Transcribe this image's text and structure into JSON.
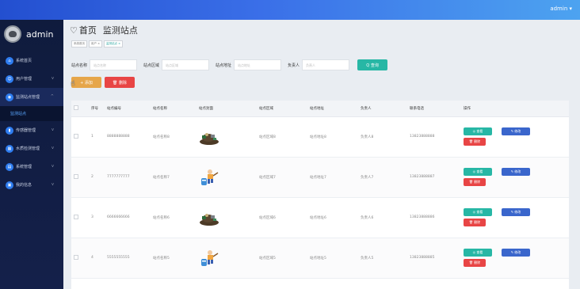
{
  "topbar": {
    "user": "admin ▾"
  },
  "sidebar": {
    "brand": "admin",
    "items": [
      {
        "label": "系统首页",
        "icon": "home-icon",
        "color": "#2f7df0",
        "arrow": ""
      },
      {
        "label": "用户管理",
        "icon": "user-icon",
        "color": "#2f7df0",
        "arrow": "v"
      },
      {
        "label": "监测站点管理",
        "icon": "location-icon",
        "color": "#2f7df0",
        "arrow": "^"
      },
      {
        "label": "传感器管理",
        "icon": "chart-icon",
        "color": "#2f7df0",
        "arrow": "v"
      },
      {
        "label": "水质检测管理",
        "icon": "grid-icon",
        "color": "#2f7df0",
        "arrow": "v"
      },
      {
        "label": "系统管理",
        "icon": "settings-icon",
        "color": "#2f7df0",
        "arrow": "v"
      },
      {
        "label": "我的信息",
        "icon": "info-icon",
        "color": "#2f7df0",
        "arrow": "v"
      }
    ],
    "subitem": "监测站点"
  },
  "page": {
    "home": "首页",
    "title": "监测站点",
    "crumbs": [
      "系统首页",
      "用户 ×",
      "监测站点 ×"
    ]
  },
  "search": {
    "fields": [
      {
        "label": "站点名称",
        "placeholder": "站点名称"
      },
      {
        "label": "站点区域",
        "placeholder": "站点区域"
      },
      {
        "label": "站点地址",
        "placeholder": "站点地址"
      },
      {
        "label": "负责人",
        "placeholder": "负责人"
      }
    ],
    "button": "Q 查询"
  },
  "toolbar": {
    "add": "+ 添加",
    "delete": "🗑 删除"
  },
  "table": {
    "headers": [
      "",
      "序号",
      "站点编号",
      "站点名称",
      "站点封面",
      "站点区域",
      "站点地址",
      "负责人",
      "联系电话",
      "操作"
    ],
    "rows": [
      {
        "no": "1",
        "code": "8888888888",
        "name": "站点名称8",
        "area": "站点区域8",
        "addr": "站点地址8",
        "person": "负责人8",
        "phone": "13823888888",
        "pic": "trash"
      },
      {
        "no": "2",
        "code": "7777777777",
        "name": "站点名称7",
        "area": "站点区域7",
        "addr": "站点地址7",
        "person": "负责人7",
        "phone": "13823888887",
        "pic": "worker"
      },
      {
        "no": "3",
        "code": "6666666666",
        "name": "站点名称6",
        "area": "站点区域6",
        "addr": "站点地址6",
        "person": "负责人6",
        "phone": "13823888886",
        "pic": "trash"
      },
      {
        "no": "4",
        "code": "5555555555",
        "name": "站点名称5",
        "area": "站点区域5",
        "addr": "站点地址5",
        "person": "负责人5",
        "phone": "13823888885",
        "pic": "worker"
      }
    ],
    "ops": {
      "view": "◎ 查看",
      "edit": "✎ 修改",
      "del": "🗑 删除"
    }
  }
}
